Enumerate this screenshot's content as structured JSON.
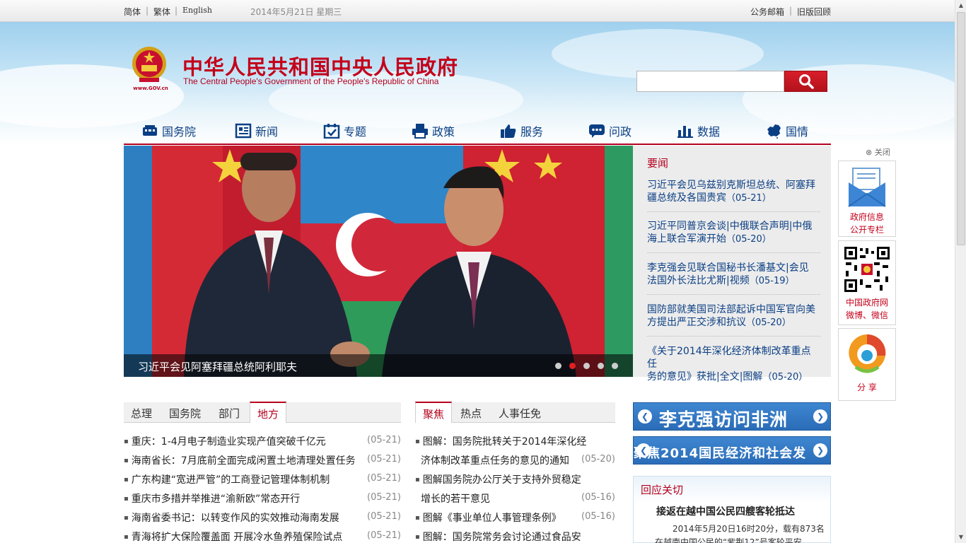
{
  "topbar": {
    "lang_simplified": "简体",
    "lang_traditional": "繁体",
    "lang_english": "English",
    "date": "2014年5月21日 星期三",
    "mailbox": "公务邮箱",
    "old_version": "旧版回顾"
  },
  "header": {
    "emblem_caption": "www.GOV.cn",
    "title": "中华人民共和国中央人民政府",
    "subtitle": "The Central People's Government of the People's Republic of China",
    "search_placeholder": ""
  },
  "nav": [
    {
      "label": "国务院",
      "icon": "state-council-icon"
    },
    {
      "label": "新闻",
      "icon": "newspaper-icon"
    },
    {
      "label": "专题",
      "icon": "calendar-check-icon"
    },
    {
      "label": "政策",
      "icon": "printer-icon"
    },
    {
      "label": "服务",
      "icon": "thumbs-up-icon"
    },
    {
      "label": "问政",
      "icon": "chat-icon"
    },
    {
      "label": "数据",
      "icon": "bar-chart-icon"
    },
    {
      "label": "国情",
      "icon": "china-map-icon"
    }
  ],
  "slider": {
    "caption": "习近平会见阿塞拜疆总统阿利耶夫",
    "slide_count": 5,
    "active_slide": 2
  },
  "important_news": {
    "title": "要闻",
    "items": [
      {
        "line1": "习近平会见乌兹别克斯坦总统、阿塞拜",
        "line2": "疆总统及各国贵宾",
        "date": "（05-21）"
      },
      {
        "line1": "习近平同普京会谈|中俄联合声明|中俄",
        "line2": "海上联合军演开始",
        "date": "（05-20）"
      },
      {
        "line1": "李克强会见联合国秘书长潘基文|会见",
        "line2": "法国外长法比尤斯|视频",
        "date": "（05-19）"
      },
      {
        "line1": "国防部就美国司法部起诉中国军官向美",
        "line2": "方提出严正交涉和抗议",
        "date": "（05-20）"
      },
      {
        "line1": "《关于2014年深化经济体制改革重点任",
        "line2": "务的意见》获批|全文|图解",
        "date": "（05-20）"
      }
    ]
  },
  "float": {
    "close": "关闭",
    "info_label1": "政府信息",
    "info_label2": "公开专栏",
    "qr_label1": "中国政府网",
    "qr_label2": "微博、微信",
    "share_label": "分 享"
  },
  "left_col": {
    "tabs": [
      "总理",
      "国务院",
      "部门",
      "地方"
    ],
    "active_tab": "地方",
    "items": [
      {
        "text": "重庆：1-4月电子制造业实现产值突破千亿元",
        "date": "(05-21)"
      },
      {
        "text": "海南省长：7月底前全面完成闲置土地清理处置任务",
        "date": "(05-21)"
      },
      {
        "text": "广东构建“宽进严管”的工商登记管理体制机制",
        "date": "(05-21)"
      },
      {
        "text": "重庆市多措并举推进“渝新欧”常态开行",
        "date": "(05-21)"
      },
      {
        "text": "海南省委书记：以转变作风的实效推动海南发展",
        "date": "(05-21)"
      },
      {
        "text": "青海将扩大保险覆盖面 开展冷水鱼养殖保险试点",
        "date": "(05-21)"
      }
    ]
  },
  "mid_col": {
    "tabs": [
      "聚焦",
      "热点",
      "人事任免"
    ],
    "active_tab": "聚焦",
    "items": [
      {
        "line1": "图解：国务院批转关于2014年深化经",
        "line2": "济体制改革重点任务的意见的通知",
        "date": "(05-20)"
      },
      {
        "line1": "图解国务院办公厅关于支持外贸稳定",
        "line2": "增长的若干意见",
        "date": "(05-16)"
      },
      {
        "line1": "图解《事业单位人事管理条例》",
        "line2": "",
        "date": "(05-16)"
      },
      {
        "line1": "图解：国务院常务会讨论通过食品安",
        "line2": "",
        "date": ""
      }
    ]
  },
  "banners": [
    {
      "text": "李克强访问非洲"
    },
    {
      "text": "聚焦2014国民经济和社会发"
    }
  ],
  "reply": {
    "title": "回应关切",
    "headline": "接返在越中国公民四艘客轮抵达",
    "body1": "2014年5月20日16时20分，载有873名",
    "body2": "在越南中国公民的“紫荆12”号客轮平安"
  },
  "colors": {
    "brand_red": "#c4001a",
    "link_blue": "#0b3f84",
    "banner_blue": "#2a6cb7"
  }
}
